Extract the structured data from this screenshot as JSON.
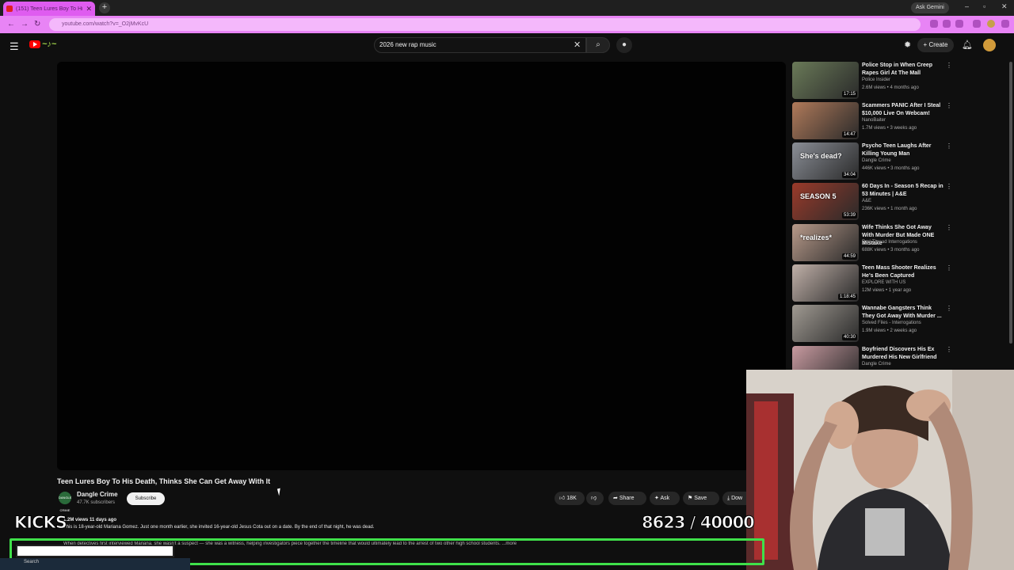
{
  "browser": {
    "tab_title": "(151) Teen Lures Boy To Hi...",
    "tab_close": "✕",
    "new_tab": "+",
    "ask_gemini": "Ask Gemini",
    "url": "youtube.com/watch?v=_O2jMvKcU"
  },
  "header": {
    "search_value": "2026 new rap music",
    "create_label": "Create"
  },
  "video": {
    "title": "Teen Lures Boy To His Death, Thinks She Can Get Away With It",
    "channel_name": "Dangle Crime",
    "channel_avatar_text": "DANGLE CRIME",
    "subscribers": "47.7K subscribers",
    "subscribe_label": "Subscribe",
    "likes": "18K",
    "share_label": "Share",
    "ask_label": "Ask",
    "save_label": "Save",
    "download_label": "Dow",
    "views_meta": "1.2M views  11 days ago",
    "description_line1": "This is 18-year-old Mariana Gomez. Just one month earlier, she invited 16-year-old Jesus Cota out on a date. By the end of that night, he was dead.",
    "description_line2": "When detectives first interviewed Mariana, she wasn't a suspect — she was a witness, helping investigators piece together the timeline that would ultimately lead to the arrest of two other high school students.   ...more"
  },
  "overlay": {
    "kicks_label": "KICKS",
    "counter_text": "8623  / 40000",
    "taskbar_search": "Search"
  },
  "recommendations": [
    {
      "title": "Police Stop in When Creep Rapes Girl At The Mall",
      "channel": "Police Insider",
      "meta": "2.6M views • 4 months ago",
      "duration": "17:15",
      "thumb_text": "",
      "color": "#6a7a58"
    },
    {
      "title": "Scammers PANIC After I Steal $10,000 Live On Webcam!",
      "channel": "NanoBaiter",
      "meta": "1.7M views • 3 weeks ago",
      "duration": "14:47",
      "thumb_text": "",
      "color": "#b07a5a"
    },
    {
      "title": "Psycho Teen Laughs After Killing Young Man",
      "channel": "Dangle Crime",
      "meta": "446K views • 3 months ago",
      "duration": "34:04",
      "thumb_text": "She's dead?",
      "color": "#8a8e96"
    },
    {
      "title": "60 Days In - Season 5 Recap in 53 Minutes | A&E",
      "channel": "A&E",
      "meta": "236K views • 1 month ago",
      "duration": "53:39",
      "thumb_text": "SEASON 5",
      "color": "#9a3a2a"
    },
    {
      "title": "Wife Thinks She Got Away With Murder But Made ONE Mistake",
      "channel": "Red Thread Interrogations",
      "meta": "688K views • 3 months ago",
      "duration": "44:59",
      "thumb_text": "*realizes*",
      "color": "#b89a8a"
    },
    {
      "title": "Teen Mass Shooter Realizes He's Been Captured",
      "channel": "EXPLORE WITH US",
      "meta": "12M views • 1 year ago",
      "duration": "1:18:45",
      "thumb_text": "",
      "color": "#c0b0a8"
    },
    {
      "title": "Wannabe Gangsters Think They Got Away With Murder ...",
      "channel": "Solved Files - Interrogations",
      "meta": "1.9M views • 2 weeks ago",
      "duration": "40:30",
      "thumb_text": "",
      "color": "#a09a92"
    },
    {
      "title": "Boyfriend Discovers His Ex Murdered His New Girlfriend",
      "channel": "Dangle Crime",
      "meta": "",
      "duration": "",
      "thumb_text": "",
      "color": "#c89aa0"
    }
  ]
}
